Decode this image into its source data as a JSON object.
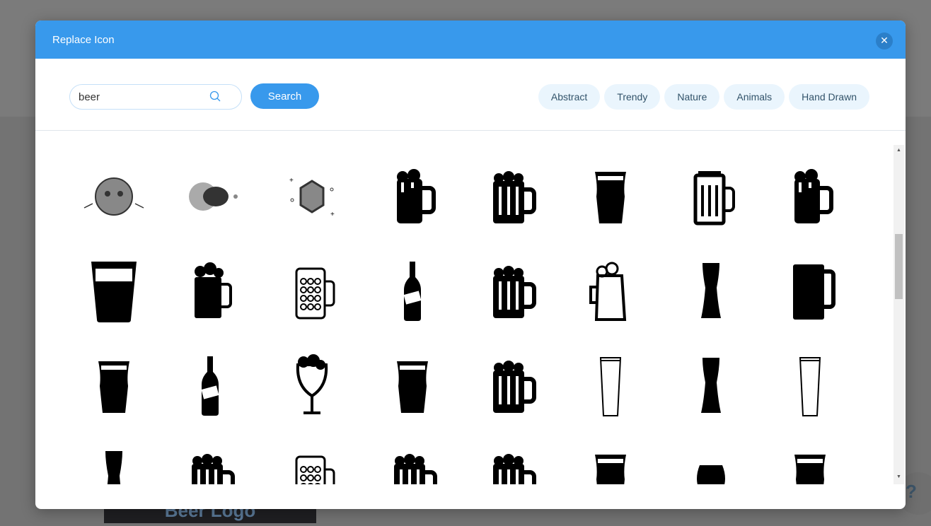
{
  "background": {
    "card_text": "Beer Logo",
    "help_label": "?"
  },
  "modal": {
    "title": "Replace Icon",
    "close_icon": "close-icon"
  },
  "search": {
    "value": "beer",
    "button": "Search",
    "icon": "search-icon"
  },
  "categories": [
    "Abstract",
    "Trendy",
    "Nature",
    "Animals",
    "Hand Drawn"
  ],
  "colors": {
    "accent": "#3899ec",
    "chip_bg": "#eaf5fd"
  },
  "icons": [
    [
      "tiger",
      "abstract-circles",
      "gem",
      "foam-mug",
      "striped-mug",
      "pint-glass",
      "stein",
      "foam-mug"
    ],
    [
      "glass",
      "foam-mug-outline",
      "dotted-stein",
      "bottle",
      "striped-mug",
      "pitcher",
      "tall-glass",
      "mug"
    ],
    [
      "pint-glass",
      "bottle",
      "goblet",
      "pint-glass",
      "striped-mug",
      "tall-glass-outline",
      "tall-glass",
      "tall-glass-outline"
    ],
    [
      "tall-glass",
      "striped-mug",
      "dotted-stein",
      "striped-mug",
      "striped-mug",
      "pint-glass",
      "tulip-glass",
      "pint-glass"
    ]
  ]
}
